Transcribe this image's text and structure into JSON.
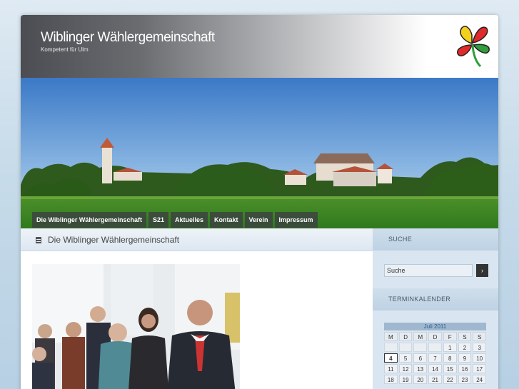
{
  "site": {
    "title": "Wiblinger Wählergemeinschaft",
    "tagline": "Kompetent für Ulm"
  },
  "nav": {
    "items": [
      {
        "label": "Die Wiblinger Wählergemeinschaft"
      },
      {
        "label": "S21"
      },
      {
        "label": "Aktuelles"
      },
      {
        "label": "Kontakt"
      },
      {
        "label": "Verein"
      },
      {
        "label": "Impressum"
      }
    ]
  },
  "content": {
    "title": "Die Wiblinger Wählergemeinschaft"
  },
  "sidebar": {
    "search_heading": "SUCHE",
    "search_value": "Suche",
    "search_button": "›",
    "calendar_heading": "TERMINKALENDER",
    "calendar": {
      "month": "Juli 2011",
      "weekdays": [
        "M",
        "D",
        "M",
        "D",
        "F",
        "S",
        "S"
      ],
      "weeks": [
        [
          "",
          "",
          "",
          "",
          "1",
          "2",
          "3"
        ],
        [
          "4",
          "5",
          "6",
          "7",
          "8",
          "9",
          "10"
        ],
        [
          "11",
          "12",
          "13",
          "14",
          "15",
          "16",
          "17"
        ],
        [
          "18",
          "19",
          "20",
          "21",
          "22",
          "23",
          "24"
        ]
      ],
      "today": "4"
    }
  },
  "icons": {
    "logo": "four-leaf-clover-logo",
    "content_icon": "document-icon"
  }
}
